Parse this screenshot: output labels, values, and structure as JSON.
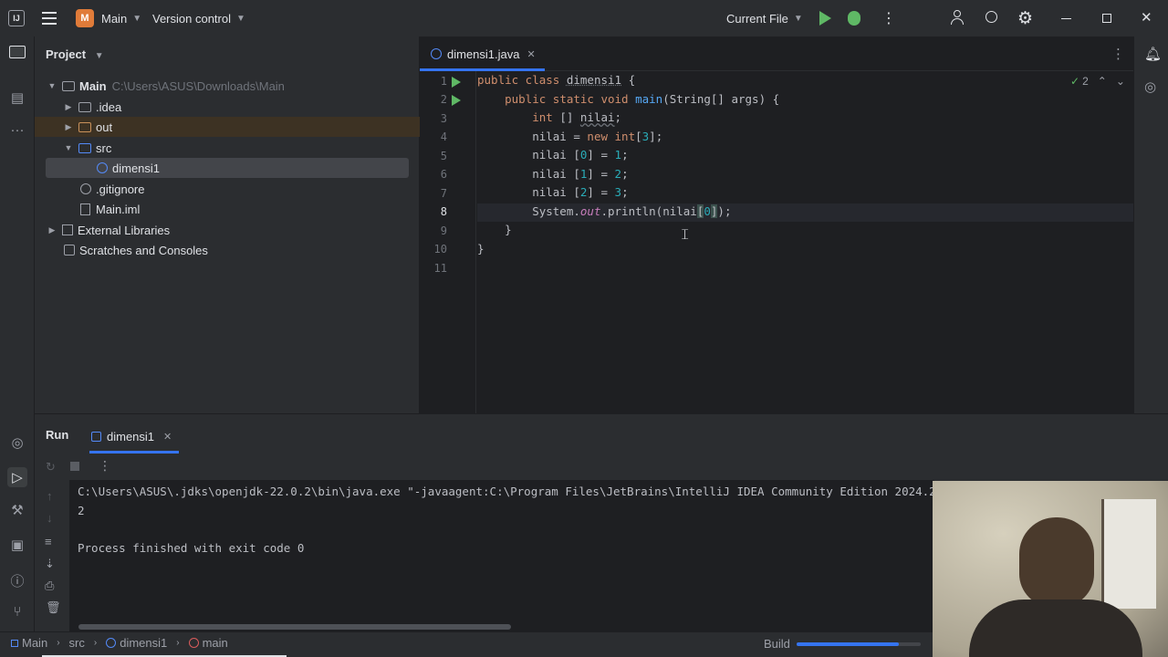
{
  "titlebar": {
    "project_badge": "M",
    "project_name": "Main",
    "vcs": "Version control",
    "run_config": "Current File",
    "icons": [
      "app-icon",
      "hamburger-icon",
      "run-icon",
      "debug-icon",
      "more-icon",
      "add-user-icon",
      "search-icon",
      "settings-icon",
      "minimize-icon",
      "restore-icon",
      "close-icon"
    ]
  },
  "project_panel": {
    "title": "Project",
    "root_name": "Main",
    "root_path": "C:\\Users\\ASUS\\Downloads\\Main",
    "items": [
      {
        "label": ".idea"
      },
      {
        "label": "out"
      },
      {
        "label": "src"
      },
      {
        "label": "dimensi1"
      },
      {
        "label": ".gitignore"
      },
      {
        "label": "Main.iml"
      },
      {
        "label": "External Libraries"
      },
      {
        "label": "Scratches and Consoles"
      }
    ]
  },
  "editor": {
    "tab": "dimensi1.java",
    "inspections": "2",
    "current_line": "8",
    "lines": [
      "1",
      "2",
      "3",
      "4",
      "5",
      "6",
      "7",
      "8",
      "9",
      "10",
      "11"
    ]
  },
  "run_panel": {
    "title": "Run",
    "tab": "dimensi1",
    "command": "C:\\Users\\ASUS\\.jdks\\openjdk-22.0.2\\bin\\java.exe \"-javaagent:C:\\Program Files\\JetBrains\\IntelliJ IDEA Community Edition 2024.2",
    "output": "2",
    "exit": "Process finished with exit code 0"
  },
  "statusbar": {
    "crumbs": [
      "Main",
      "src",
      "dimensi1",
      "main"
    ],
    "build": "Build",
    "build_progress": 0.82
  },
  "colors": {
    "accent": "#3574f0",
    "keyword": "#cf8e6d",
    "function": "#56a8f5",
    "number": "#2aacb8"
  }
}
